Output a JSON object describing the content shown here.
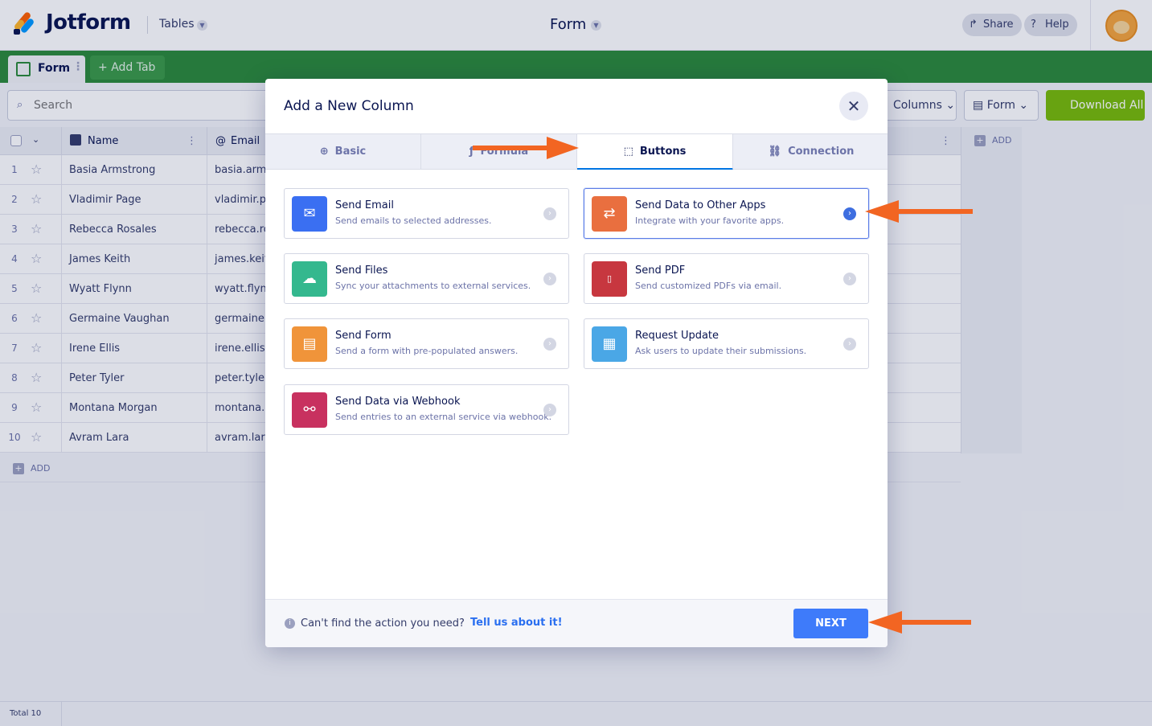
{
  "app": {
    "brand": "Jotform",
    "section_menu": "Tables",
    "form_title": "Form",
    "share_label": "Share",
    "help_label": "Help"
  },
  "tabs": {
    "active_tab": "Form",
    "add_tab": "Add Tab"
  },
  "toolbar": {
    "search_placeholder": "Search",
    "columns_label": "Columns",
    "form_view_label": "Form",
    "download_label": "Download All"
  },
  "table": {
    "columns": [
      "Name",
      "Email"
    ],
    "add_column_label": "ADD",
    "add_row_label": "ADD",
    "rows": [
      {
        "num": "1",
        "name": "Basia Armstrong",
        "email": "basia.armst"
      },
      {
        "num": "2",
        "name": "Vladimir Page",
        "email": "vladimir.pa"
      },
      {
        "num": "3",
        "name": "Rebecca Rosales",
        "email": "rebecca.ro"
      },
      {
        "num": "4",
        "name": "James Keith",
        "email": "james.keith"
      },
      {
        "num": "5",
        "name": "Wyatt Flynn",
        "email": "wyatt.flynn"
      },
      {
        "num": "6",
        "name": "Germaine Vaughan",
        "email": "germaine.v"
      },
      {
        "num": "7",
        "name": "Irene Ellis",
        "email": "irene.ellis@"
      },
      {
        "num": "8",
        "name": "Peter Tyler",
        "email": "peter.tyler@"
      },
      {
        "num": "9",
        "name": "Montana Morgan",
        "email": "montana.m"
      },
      {
        "num": "10",
        "name": "Avram Lara",
        "email": "avram.lara@"
      }
    ],
    "total_label": "Total 10"
  },
  "modal": {
    "title": "Add a New Column",
    "tabs": [
      {
        "label": "Basic",
        "icon": "plus-circle-icon"
      },
      {
        "label": "Formula",
        "icon": "function-icon"
      },
      {
        "label": "Buttons",
        "icon": "cursor-icon"
      },
      {
        "label": "Connection",
        "icon": "link-icon"
      }
    ],
    "active_tab": "Buttons",
    "actions": [
      {
        "title": "Send Email",
        "desc": "Send emails to selected addresses.",
        "icon": "envelope-icon",
        "color": "#3a6ff2"
      },
      {
        "title": "Send Data to Other Apps",
        "desc": "Integrate with your favorite apps.",
        "icon": "apps-icon",
        "color": "#e96f3f"
      },
      {
        "title": "Send Files",
        "desc": "Sync your attachments to external services.",
        "icon": "cloud-upload-icon",
        "color": "#34b88e"
      },
      {
        "title": "Send PDF",
        "desc": "Send customized PDFs via email.",
        "icon": "pdf-icon",
        "color": "#c7373f"
      },
      {
        "title": "Send Form",
        "desc": "Send a form with pre-populated answers.",
        "icon": "form-icon",
        "color": "#f0943a"
      },
      {
        "title": "Request Update",
        "desc": "Ask users to update their submissions.",
        "icon": "document-icon",
        "color": "#4aa7e6"
      },
      {
        "title": "Send Data via Webhook",
        "desc": "Send entries to an external service via webhook.",
        "icon": "webhook-icon",
        "color": "#c8315f"
      }
    ],
    "selected_action": "Send Data to Other Apps",
    "footer_question": "Can't find the action you need?",
    "footer_link": "Tell us about it!",
    "next_label": "NEXT"
  },
  "annotation": {
    "arrow_color": "#f26522"
  }
}
